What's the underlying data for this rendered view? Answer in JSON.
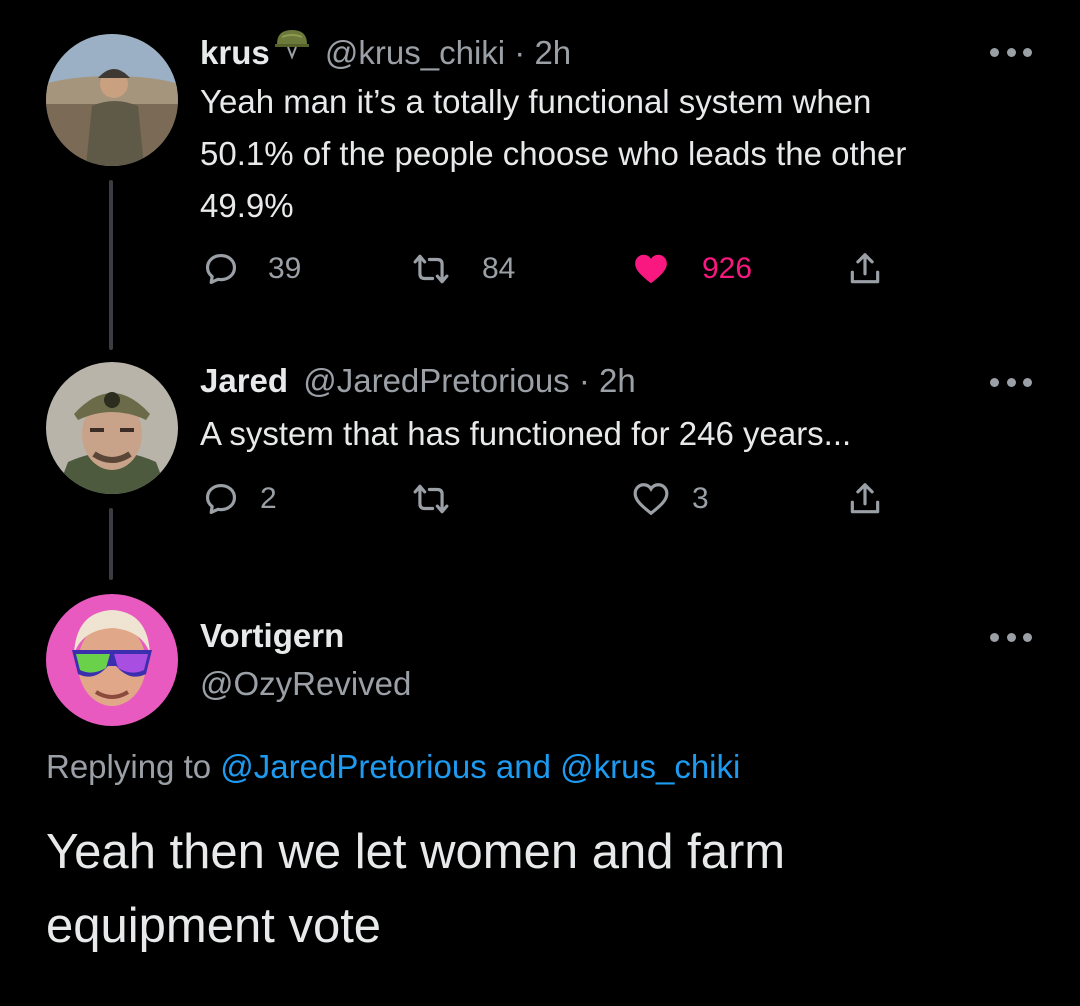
{
  "tweets": [
    {
      "name": "krus",
      "handle": "@krus_chiki",
      "sep": " · ",
      "time": "2h",
      "text_lines": [
        "Yeah man it’s a totally functional system when",
        "50.1% of the people choose who leads the other",
        "49.9%"
      ],
      "replies": "39",
      "retweets": "84",
      "likes": "926",
      "liked": true
    },
    {
      "name": "Jared",
      "handle": "@JaredPretorious",
      "sep": " · ",
      "time": "2h",
      "text": "A system that has functioned for 246 years...",
      "replies": "2",
      "retweets": "",
      "likes": "3",
      "liked": false
    }
  ],
  "main_tweet": {
    "name": "Vortigern",
    "handle": "@OzyRevived",
    "replying_prefix": "Replying to ",
    "mention_1": "@JaredPretorious",
    "and_word": " and ",
    "mention_2": "@krus_chiki",
    "text_lines": [
      "Yeah then we let women and farm",
      "equipment vote"
    ]
  },
  "colors": {
    "background": "#000000",
    "text": "#e7e9ea",
    "secondary": "#9aa0a6",
    "like_pink": "#f91880",
    "link_blue": "#1d9bf0"
  },
  "icons": [
    "reply-icon",
    "retweet-icon",
    "heart-icon",
    "share-icon",
    "more-icon",
    "helmet-icon"
  ]
}
